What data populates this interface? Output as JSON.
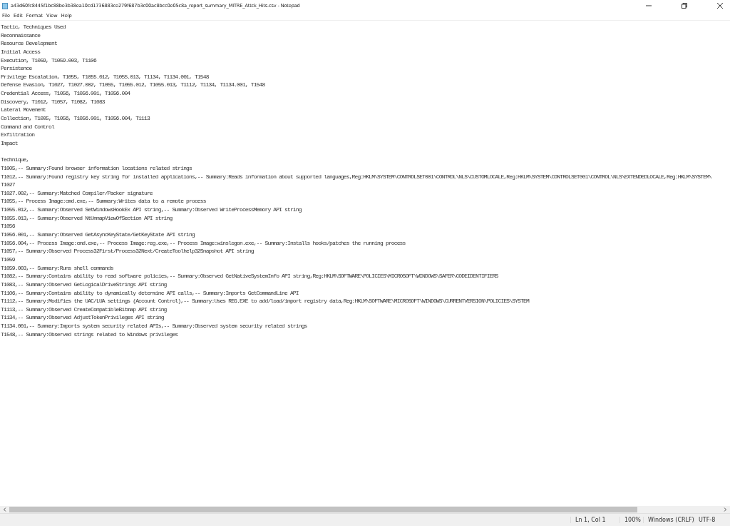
{
  "window": {
    "title": "a43d60fc8445f1bc88be3b38ea10cd1736883ce279f687b3c00ac8bcc0e05c8a_report_summary_MITRE_Attck_Hits.csv - Notepad"
  },
  "menu": [
    "File",
    "Edit",
    "Format",
    "View",
    "Help"
  ],
  "editor": {
    "tactics": [
      "Tactic, Techniques Used",
      "Reconnaissance",
      "Resource Development",
      "Initial Access",
      "Execution, T1059, T1059.003, T1106",
      "Persistence",
      "Privilege Escalation, T1055, T1055.012, T1055.013, T1134, T1134.001, T1548",
      "Defense Evasion, T1027, T1027.002, T1055, T1055.012, T1055.013, T1112, T1134, T1134.001, T1548",
      "Credential Access, T1056, T1056.001, T1056.004",
      "Discovery, T1012, T1057, T1082, T1083",
      "Lateral Movement",
      "Collection, T1005, T1056, T1056.001, T1056.004, T1113",
      "Command and Control",
      "Exfiltration",
      "Impact"
    ],
    "techniques": [
      "Technique,",
      "T1005,-- Summary:Found browser information locations related strings",
      "T1012,-- Summary:Found registry key string for installed applications,-- Summary:Reads information about supported languages,Reg:HKLM\\SYSTEM\\CONTROLSET001\\CONTROL\\NLS\\CUSTOMLOCALE,Reg:HKLM\\SYSTEM\\CONTROLSET001\\CONTROL\\NLS\\EXTENDEDLOCALE,Reg:HKLM\\SYSTEM\\",
      "T1027",
      "T1027.002,-- Summary:Matched Compiler/Packer signature",
      "T1055,-- Process Image:cmd.exe,-- Summary:Writes data to a remote process",
      "T1055.012,-- Summary:Observed SetWindowsHookEx API string,-- Summary:Observed WriteProcessMemory API string",
      "T1055.013,-- Summary:Observed NtUnmapViewOfSection API string",
      "T1056",
      "T1056.001,-- Summary:Observed GetAsyncKeyState/GetKeyState API string",
      "T1056.004,-- Process Image:cmd.exe,-- Process Image:reg.exe,-- Process Image:winslogon.exe,-- Summary:Installs hooks/patches the running process",
      "T1057,-- Summary:Observed Process32First/Process32Next/CreateToolhelp32Snapshot API string",
      "T1059",
      "T1059.003,-- Summary:Runs shell commands",
      "T1082,-- Summary:Contains ability to read software policies,-- Summary:Observed GetNativeSystemInfo API string,Reg:HKLM\\SOFTWARE\\POLICIES\\MICROSOFT\\WINDOWS\\SAFER\\CODEIDENTIFIERS",
      "T1083,-- Summary:Observed GetLogicalDriveStrings API string",
      "T1106,-- Summary:Contains ability to dynamically determine API calls,-- Summary:Imports GetCommandLine API",
      "T1112,-- Summary:Modifies the UAC/LUA settings (Account Control),-- Summary:Uses REG.EXE to add/load/import registry data,Reg:HKLM\\SOFTWARE\\MICROSOFT\\WINDOWS\\CURRENTVERSION\\POLICIES\\SYSTEM",
      "T1113,-- Summary:Observed CreateCompatibleBitmap API string",
      "T1134,-- Summary:Observed AdjustTokenPrivileges API string",
      "T1134.001,-- Summary:Imports system security related APIs,-- Summary:Observed system security related strings",
      "T1548,-- Summary:Observed strings related to Windows privileges"
    ]
  },
  "status_bar": {
    "position": "Ln 1, Col 1",
    "zoom": "100%",
    "line_ending": "Windows (CRLF)",
    "encoding": "UTF-8"
  }
}
